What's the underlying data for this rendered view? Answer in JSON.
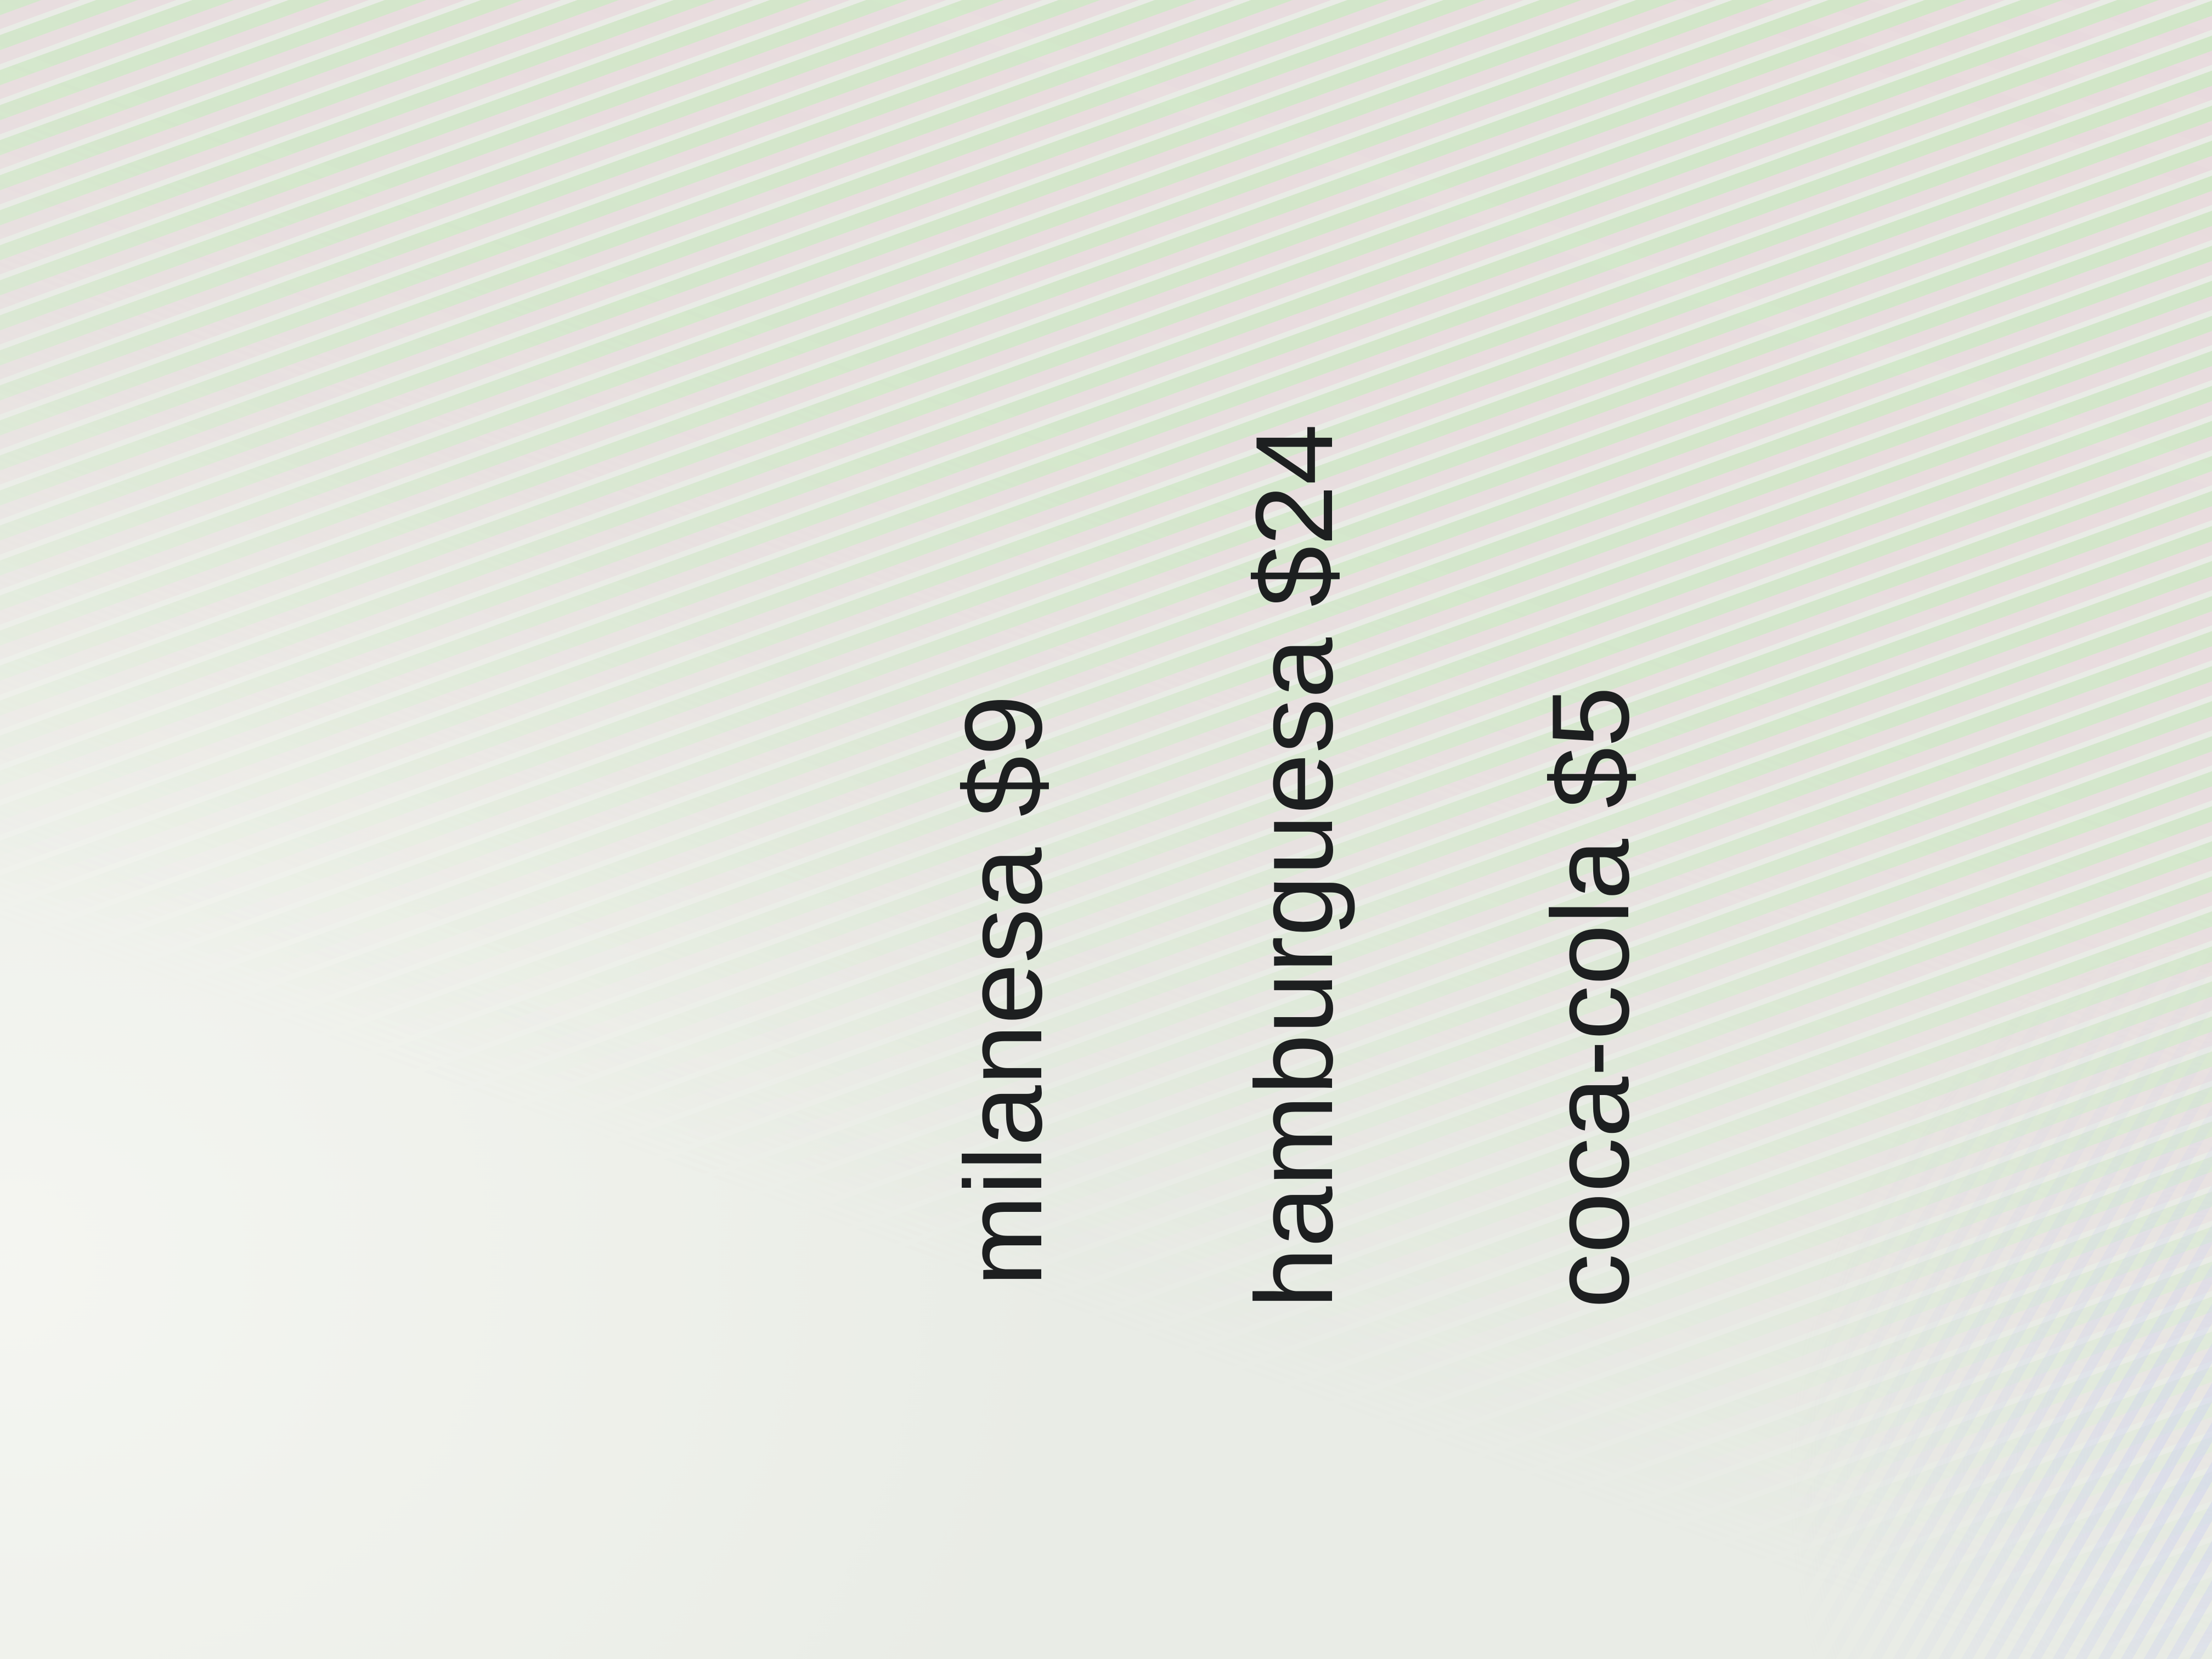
{
  "menu": {
    "items": [
      {
        "label": "milanesa $9"
      },
      {
        "label": "hamburguesa $24"
      },
      {
        "label": "coca-cola $5"
      }
    ]
  },
  "colors": {
    "text": "#1d1f20",
    "background": "#e9ece6"
  }
}
